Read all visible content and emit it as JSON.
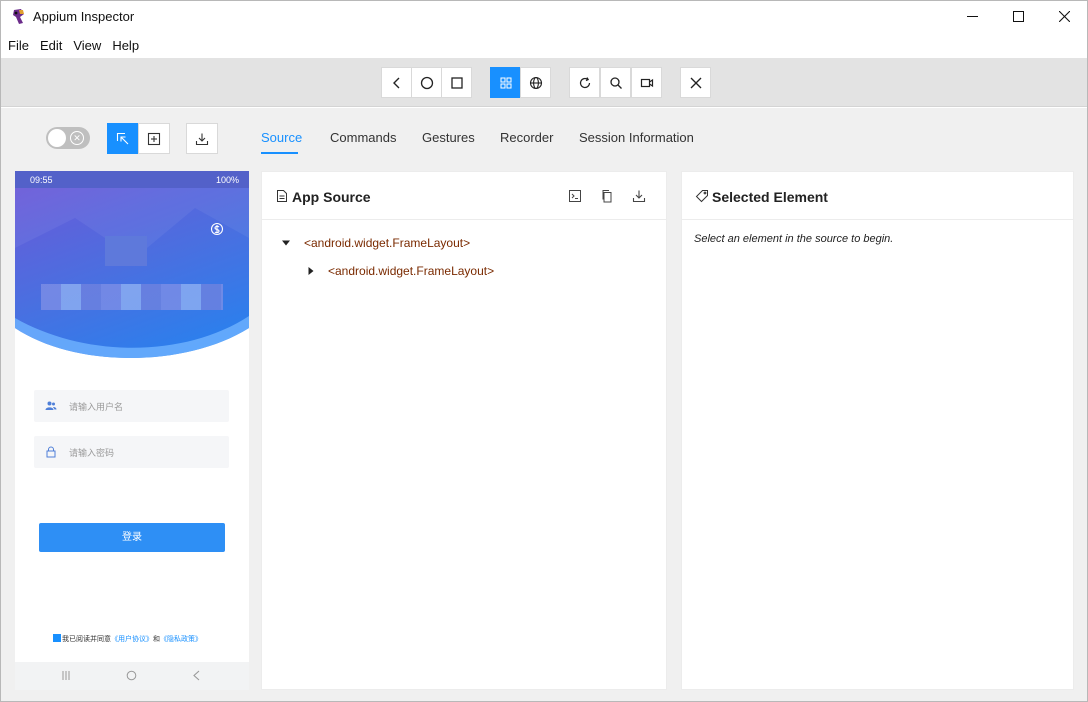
{
  "window": {
    "title": "Appium Inspector"
  },
  "menu": [
    "File",
    "Edit",
    "View",
    "Help"
  ],
  "toolbar": {
    "buttons": [
      {
        "name": "back",
        "icon": "chevron-left-icon"
      },
      {
        "name": "home",
        "icon": "circle-icon"
      },
      {
        "name": "app-switch",
        "icon": "square-icon"
      },
      {
        "name": "native-context",
        "icon": "grid-icon",
        "active": true
      },
      {
        "name": "web-context",
        "icon": "globe-icon"
      },
      {
        "name": "refresh",
        "icon": "refresh-icon"
      },
      {
        "name": "search",
        "icon": "search-icon"
      },
      {
        "name": "record",
        "icon": "video-icon"
      },
      {
        "name": "quit",
        "icon": "close-icon"
      }
    ]
  },
  "tabs": [
    {
      "label": "Source",
      "active": true
    },
    {
      "label": "Commands"
    },
    {
      "label": "Gestures"
    },
    {
      "label": "Recorder"
    },
    {
      "label": "Session Information"
    }
  ],
  "phone": {
    "status_time": "09:55",
    "status_right": "100%",
    "username_placeholder": "请输入用户名",
    "password_placeholder": "请输入密码",
    "login_label": "登录",
    "agree_prefix": "我已阅读并同意",
    "agree_link1": "《用户协议》",
    "agree_and": "和",
    "agree_link2": "《隐私政策》"
  },
  "source_panel": {
    "title": "App Source",
    "tree": [
      {
        "label": "<android.widget.FrameLayout>",
        "expanded": true,
        "depth": 0
      },
      {
        "label": "<android.widget.FrameLayout>",
        "expanded": false,
        "depth": 1
      }
    ]
  },
  "selected_panel": {
    "title": "Selected Element",
    "hint": "Select an element in the source to begin."
  },
  "colors": {
    "accent": "#1890ff",
    "tree_text": "#7a2a00"
  }
}
